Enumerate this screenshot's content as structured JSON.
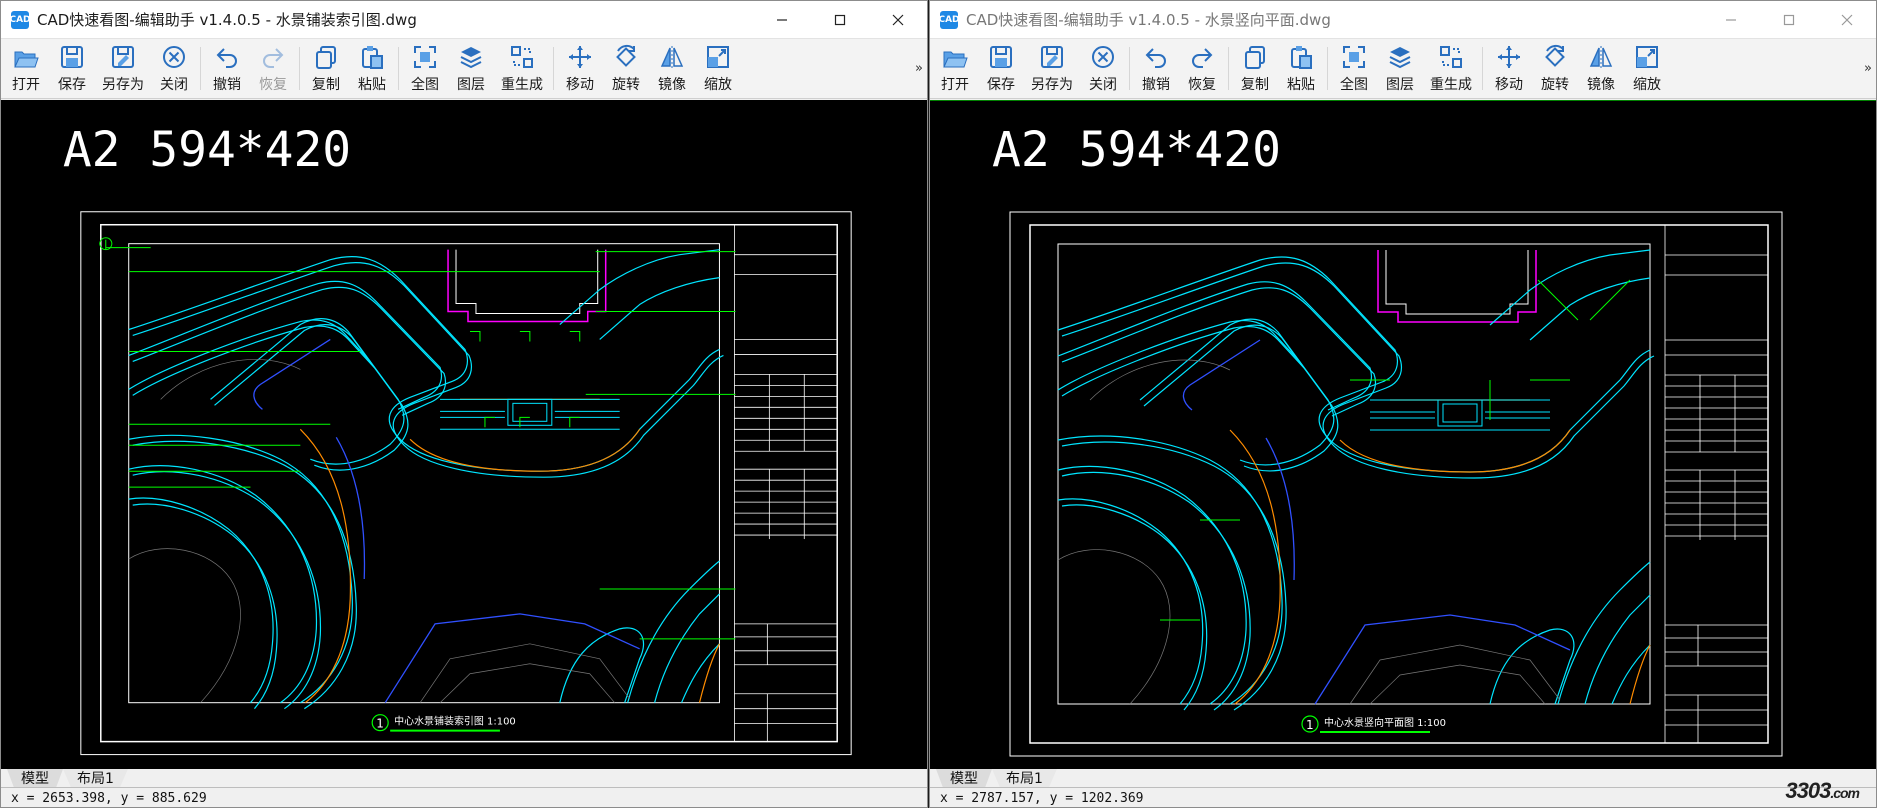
{
  "colors": {
    "cyan": "#00e5ff",
    "green": "#00ff00",
    "orange": "#ff8c00",
    "blue": "#3050ff",
    "magenta": "#ff00ff",
    "white": "#ffffff"
  },
  "windows": [
    {
      "title": "CAD快速看图-编辑助手 v1.4.0.5 - 水景铺装索引图.dwg",
      "app_icon": "CAD",
      "toolbar": [
        {
          "icon": "open-icon",
          "label": "打开"
        },
        {
          "icon": "save-icon",
          "label": "保存"
        },
        {
          "icon": "save-as-icon",
          "label": "另存为"
        },
        {
          "icon": "close-circle-icon",
          "label": "关闭"
        },
        {
          "icon": "undo-icon",
          "label": "撤销"
        },
        {
          "icon": "redo-icon",
          "label": "恢复",
          "disabled": true
        },
        {
          "icon": "copy-icon",
          "label": "复制"
        },
        {
          "icon": "paste-icon",
          "label": "粘贴"
        },
        {
          "icon": "fit-all-icon",
          "label": "全图"
        },
        {
          "icon": "layers-icon",
          "label": "图层"
        },
        {
          "icon": "regen-icon",
          "label": "重生成"
        },
        {
          "icon": "move-icon",
          "label": "移动"
        },
        {
          "icon": "rotate-icon",
          "label": "旋转"
        },
        {
          "icon": "mirror-icon",
          "label": "镜像"
        },
        {
          "icon": "scale-icon",
          "label": "缩放"
        }
      ],
      "more": "»",
      "drawing": {
        "sheet_title": "A2 594*420",
        "caption": "中心水景铺装索引图 1:100",
        "caption_number": "1"
      },
      "tabs": [
        "模型",
        "布局1"
      ],
      "status": "x = 2653.398, y = 885.629"
    },
    {
      "title": "CAD快速看图-编辑助手 v1.4.0.5 - 水景竖向平面.dwg",
      "app_icon": "CAD",
      "toolbar": [
        {
          "icon": "open-icon",
          "label": "打开"
        },
        {
          "icon": "save-icon",
          "label": "保存"
        },
        {
          "icon": "save-as-icon",
          "label": "另存为"
        },
        {
          "icon": "close-circle-icon",
          "label": "关闭"
        },
        {
          "icon": "undo-icon",
          "label": "撤销"
        },
        {
          "icon": "redo-icon",
          "label": "恢复"
        },
        {
          "icon": "copy-icon",
          "label": "复制"
        },
        {
          "icon": "paste-icon",
          "label": "粘贴"
        },
        {
          "icon": "fit-all-icon",
          "label": "全图"
        },
        {
          "icon": "layers-icon",
          "label": "图层"
        },
        {
          "icon": "regen-icon",
          "label": "重生成"
        },
        {
          "icon": "move-icon",
          "label": "移动"
        },
        {
          "icon": "rotate-icon",
          "label": "旋转"
        },
        {
          "icon": "mirror-icon",
          "label": "镜像"
        },
        {
          "icon": "scale-icon",
          "label": "缩放"
        }
      ],
      "more": "»",
      "drawing": {
        "sheet_title": "A2 594*420",
        "caption": "中心水景竖向平面图 1:100",
        "caption_number": "1"
      },
      "tabs": [
        "模型",
        "布局1"
      ],
      "status": "x = 2787.157, y = 1202.369"
    }
  ],
  "watermark": {
    "text": "3303",
    "suffix": ".com"
  }
}
